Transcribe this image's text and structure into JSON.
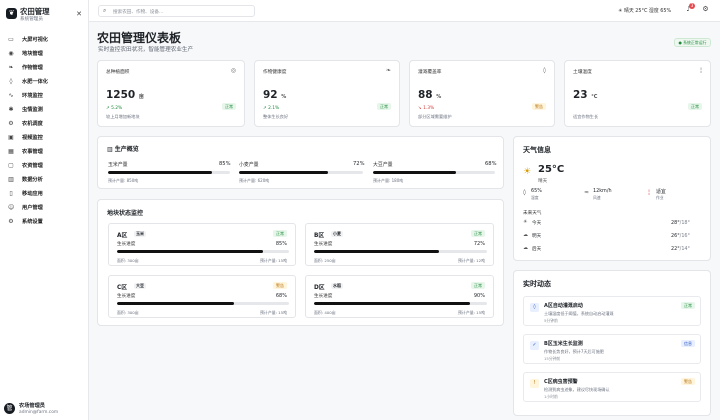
{
  "app": {
    "title": "农田管理",
    "subtitle": "系统管理员"
  },
  "sidebar": {
    "items": [
      {
        "label": "大屏可视化",
        "icon": "monitor-icon"
      },
      {
        "label": "地块管理",
        "icon": "map-pin-icon"
      },
      {
        "label": "作物管理",
        "icon": "leaf-icon"
      },
      {
        "label": "水肥一体化",
        "icon": "water-drop-icon"
      },
      {
        "label": "环境监控",
        "icon": "activity-icon"
      },
      {
        "label": "虫情监测",
        "icon": "bug-icon"
      },
      {
        "label": "农机调度",
        "icon": "tractor-icon"
      },
      {
        "label": "视频监控",
        "icon": "camera-icon"
      },
      {
        "label": "农事管理",
        "icon": "calendar-icon"
      },
      {
        "label": "农资管理",
        "icon": "box-icon"
      },
      {
        "label": "数据分析",
        "icon": "chart-icon"
      },
      {
        "label": "移动应用",
        "icon": "phone-icon"
      },
      {
        "label": "用户管理",
        "icon": "users-icon"
      },
      {
        "label": "系统设置",
        "icon": "gear-icon"
      }
    ]
  },
  "user": {
    "name": "农场管理员",
    "email": "admin@farm.com",
    "initial": "管"
  },
  "topbar": {
    "search_placeholder": "搜索农田、作物、设备...",
    "weather": "晴天 25°C  湿度 65%",
    "notifications": "3"
  },
  "page": {
    "title": "农田管理仪表板",
    "subtitle": "实时监控农田状况，智能管理农业生产",
    "realtime_label": "系统正常运行"
  },
  "kpis": [
    {
      "title": "总种植面积",
      "value": "1250",
      "unit": "亩",
      "trend": "↗ 5.2%",
      "trend_color": "#1f8a3b",
      "note": "较上月增加新地块",
      "badge": "正常",
      "badge_type": "ok",
      "icon": "map-icon"
    },
    {
      "title": "作物健康度",
      "value": "92",
      "unit": "%",
      "trend": "↗ 2.1%",
      "trend_color": "#1f8a3b",
      "note": "整体生长良好",
      "badge": "正常",
      "badge_type": "ok",
      "icon": "leaf-icon"
    },
    {
      "title": "灌溉覆盖率",
      "value": "88",
      "unit": "%",
      "trend": "↘ 1.3%",
      "trend_color": "#d23b3b",
      "note": "部分区域需要维护",
      "badge": "警告",
      "badge_type": "warn",
      "icon": "drop-icon"
    },
    {
      "title": "土壤温度",
      "value": "23",
      "unit": "°C",
      "trend": "",
      "trend_color": "#1f8a3b",
      "note": "适宜作物生长",
      "badge": "正常",
      "badge_type": "ok",
      "icon": "thermometer-icon"
    }
  ],
  "production": {
    "title": "生产概览",
    "items": [
      {
        "label": "玉米产量",
        "percent": 85,
        "percent_label": "85%",
        "target": "预计产量: 850吨"
      },
      {
        "label": "小麦产量",
        "percent": 72,
        "percent_label": "72%",
        "target": "预计产量: 620吨"
      },
      {
        "label": "大豆产量",
        "percent": 68,
        "percent_label": "68%",
        "target": "预计产量: 180吨"
      }
    ]
  },
  "plots": {
    "title": "地块状态监控",
    "items": [
      {
        "name": "A区",
        "crop": "玉米",
        "status": "正常",
        "status_type": "ok",
        "progress_label": "生长进度",
        "percent": 85,
        "percent_label": "85%",
        "area": "面积: 300亩",
        "yield": "预计产量: 15吨"
      },
      {
        "name": "B区",
        "crop": "小麦",
        "status": "正常",
        "status_type": "ok",
        "progress_label": "生长进度",
        "percent": 72,
        "percent_label": "72%",
        "area": "面积: 250亩",
        "yield": "预计产量: 12吨"
      },
      {
        "name": "C区",
        "crop": "大豆",
        "status": "警告",
        "status_type": "warn",
        "progress_label": "生长进度",
        "percent": 68,
        "percent_label": "68%",
        "area": "面积: 300亩",
        "yield": "预计产量: 15吨"
      },
      {
        "name": "D区",
        "crop": "水稻",
        "status": "正常",
        "status_type": "ok",
        "progress_label": "生长进度",
        "percent": 90,
        "percent_label": "90%",
        "area": "面积: 400亩",
        "yield": "预计产量: 15吨"
      }
    ]
  },
  "weather": {
    "title": "天气信息",
    "temp": "25°C",
    "desc": "晴天",
    "stats": [
      {
        "value": "65%",
        "label": "湿度",
        "icon": "droplet-icon"
      },
      {
        "value": "12km/h",
        "label": "风速",
        "icon": "wind-icon"
      },
      {
        "value": "适宜",
        "label": "作业",
        "icon": "thermometer-icon"
      }
    ],
    "forecast_title": "未来天气",
    "forecast": [
      {
        "day": "今天",
        "high": "28°",
        "low": "/18°",
        "icon": "sun-icon"
      },
      {
        "day": "明天",
        "high": "26°",
        "low": "/16°",
        "icon": "cloud-icon"
      },
      {
        "day": "后天",
        "high": "22°",
        "low": "/14°",
        "icon": "cloud-icon"
      }
    ]
  },
  "activity": {
    "title": "实时动态",
    "items": [
      {
        "title": "A区自动灌溉启动",
        "desc": "土壤湿度低于阈值，系统自动启动灌溉",
        "time": "5分钟前",
        "badge": "正常",
        "badge_type": "ok",
        "icon": "drop-icon",
        "icon_color": "#2b59c3",
        "icon_bg": "#e8efff"
      },
      {
        "title": "B区玉米生长监测",
        "desc": "作物长势良好，预计7天后可施肥",
        "time": "15分钟前",
        "badge": "信息",
        "badge_type": "info",
        "icon": "check-icon",
        "icon_color": "#2b59c3",
        "icon_bg": "#e8efff"
      },
      {
        "title": "C区病虫害预警",
        "desc": "检测到病虫迹象，建议尽快现场确认",
        "time": "1小时前",
        "badge": "警告",
        "badge_type": "warn",
        "icon": "alert-icon",
        "icon_color": "#b26b00",
        "icon_bg": "#fff4dc"
      }
    ]
  }
}
